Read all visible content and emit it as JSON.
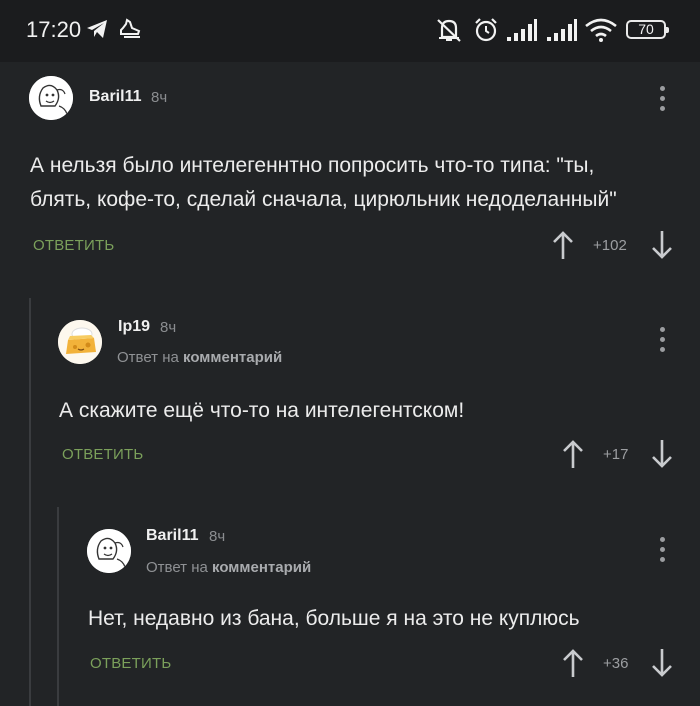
{
  "status_bar": {
    "time": "17:20",
    "battery": "70",
    "icons": [
      "telegram-icon",
      "shoe-icon",
      "mute-icon",
      "alarm-icon",
      "signal-icon",
      "signal-icon",
      "wifi-icon",
      "battery-icon"
    ]
  },
  "comments": [
    {
      "username": "Baril11",
      "time": "8ч",
      "text_line1": "А нельзя было интелегеннтно попросить что-то типа: \"ты,",
      "text_line2": "блять, кофе-то, сделай сначала, цирюльник недоделанный\"",
      "reply_label": "ОТВЕТИТЬ",
      "score": "+102",
      "avatar": "sketch-avatar"
    },
    {
      "username": "Ip19",
      "time": "8ч",
      "reply_to_prefix": "Ответ на",
      "reply_to_link": "комментарий",
      "text_line1": "А скажите ещё что-то на интелегентском!",
      "reply_label": "ОТВЕТИТЬ",
      "score": "+17",
      "avatar": "cheese-avatar"
    },
    {
      "username": "Baril11",
      "time": "8ч",
      "reply_to_prefix": "Ответ на",
      "reply_to_link": "комментарий",
      "text_line1": "Нет, недавно из бана, больше я на это не куплюсь",
      "reply_label": "ОТВЕТИТЬ",
      "score": "+36",
      "avatar": "sketch-avatar"
    }
  ],
  "colors": {
    "background": "#222426",
    "accent_reply": "#7ba05b",
    "thread_line": "#3a3c3f"
  }
}
